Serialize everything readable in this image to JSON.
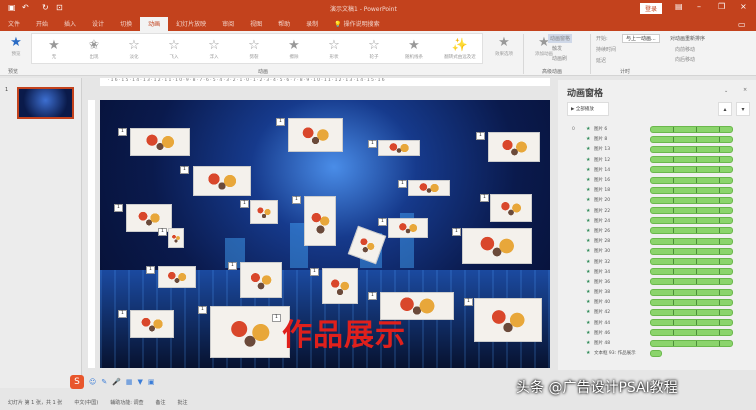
{
  "title_bar": {
    "document_title": "演示文稿1 - PowerPoint",
    "sign_in": "登录"
  },
  "tabs": [
    "文件",
    "开始",
    "插入",
    "设计",
    "切换",
    "动画",
    "幻灯片放映",
    "审阅",
    "视图",
    "帮助",
    "录制"
  ],
  "active_tab": "动画",
  "tell_me": "操作说明搜索",
  "ribbon": {
    "preview": "预览",
    "preview_group": "预览",
    "effects": [
      "无",
      "出现",
      "淡化",
      "飞入",
      "浮入",
      "劈裂",
      "擦除",
      "形状",
      "轮子",
      "随机线条",
      "翻转式由远及近"
    ],
    "effects_group": "动画",
    "effect_options": "效果选项",
    "add_animation": "添加动画",
    "animation_pane": "动画窗格",
    "trigger": "触发",
    "animation_painter": "动画刷",
    "advanced_group": "高级动画",
    "start_label": "开始:",
    "start_value": "与上一动画...",
    "duration_label": "持续时间",
    "delay_label": "延迟",
    "timing_group": "计时",
    "reorder": "对动画重新排序",
    "move_earlier": "向前移动",
    "move_later": "向后移动"
  },
  "ruler": "·16·15·14·13·12·11·10·9·8·7·6·5·4·3·2·1·0·1·2·3·4·5·6·7·8·9·10·11·12·13·14·15·16",
  "thumbnail_number": "1",
  "slide": {
    "text": "作品展示",
    "tags": [
      "1",
      "1",
      "1",
      "1",
      "1",
      "1",
      "1",
      "1",
      "1",
      "1",
      "1",
      "1",
      "1",
      "1",
      "1",
      "1",
      "1",
      "1",
      "1",
      "1",
      "1"
    ]
  },
  "animation_pane": {
    "title": "动画窗格",
    "play_button": "▶ 全部播放",
    "items": [
      {
        "num": "0",
        "name": "图片 6"
      },
      {
        "num": "",
        "name": "图片 8"
      },
      {
        "num": "",
        "name": "图片 13"
      },
      {
        "num": "",
        "name": "图片 12"
      },
      {
        "num": "",
        "name": "图片 14"
      },
      {
        "num": "",
        "name": "图片 16"
      },
      {
        "num": "",
        "name": "图片 18"
      },
      {
        "num": "",
        "name": "图片 20"
      },
      {
        "num": "",
        "name": "图片 22"
      },
      {
        "num": "",
        "name": "图片 24"
      },
      {
        "num": "",
        "name": "图片 26"
      },
      {
        "num": "",
        "name": "图片 28"
      },
      {
        "num": "",
        "name": "图片 30"
      },
      {
        "num": "",
        "name": "图片 32"
      },
      {
        "num": "",
        "name": "图片 34"
      },
      {
        "num": "",
        "name": "图片 36"
      },
      {
        "num": "",
        "name": "图片 38"
      },
      {
        "num": "",
        "name": "图片 40"
      },
      {
        "num": "",
        "name": "图片 42"
      },
      {
        "num": "",
        "name": "图片 44"
      },
      {
        "num": "",
        "name": "图片 46"
      },
      {
        "num": "",
        "name": "图片 48"
      },
      {
        "num": "",
        "name": "文本框 93: 作品展示"
      }
    ]
  },
  "status_bar": {
    "slide": "幻灯片 第 1 张，共 1 张",
    "language": "中文(中国)",
    "accessibility": "辅助功能: 调查",
    "notes": "备注",
    "comments": "批注"
  },
  "watermark": "头条 @广告设计PSAI教程",
  "colors": {
    "accent": "#c3421d",
    "timeline_bar": "#8bd46c",
    "slide_title": "#e0201c"
  }
}
